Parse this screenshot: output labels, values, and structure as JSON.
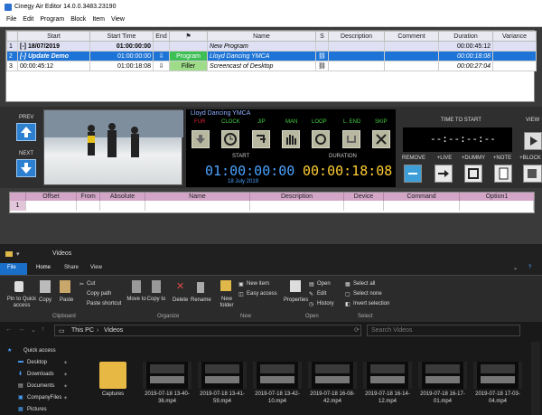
{
  "cinegy": {
    "title": "Cinegy Air Editor 14.0.0.3483.23190",
    "menu": [
      "File",
      "Edit",
      "Program",
      "Block",
      "Item",
      "View"
    ],
    "columns": [
      "",
      "Start",
      "Start Time",
      "End",
      "",
      "Name",
      "S",
      "Description",
      "Comment",
      "Duration",
      "Variance"
    ],
    "rows": [
      {
        "num": "1",
        "start": "[-] 18/07/2019",
        "start_time": "01:00:00:00",
        "type": "",
        "name": "New Program",
        "s": "",
        "duration": "00:00:45:12"
      },
      {
        "num": "2",
        "start": "[-] Update Demo",
        "start_time": "01:00:00:00",
        "type": "Program",
        "name": "Lloyd Dancing YMCA",
        "s": "",
        "duration": "00:00:18:08"
      },
      {
        "num": "3",
        "start": "00:00:45:12",
        "start_time": "01:00:18:08",
        "type": "Filler",
        "name": "Screencast of Desktop",
        "s": "",
        "duration": "00:00:27:04"
      }
    ],
    "player": {
      "prev": "PREV",
      "next": "NEXT",
      "clip_name": "Lloyd Dancing YMCA",
      "transport_labels": [
        "FUR",
        "CLOCK",
        "JIP",
        "MAN",
        "LOOP",
        "L. END",
        "SKIP"
      ],
      "start_label": "START",
      "duration_label": "DURATION",
      "start_value": "01:00:00:00",
      "duration_value": "00:00:18:08",
      "date": "18 July 2019",
      "time_to_start_label": "TIME TO START",
      "time_to_start_value": "--:--:--:--",
      "view_label": "VIEW",
      "right_labels": [
        "REMOVE",
        "+LIVE",
        "+DUMMY",
        "+NOTE",
        "+BLOCK"
      ]
    },
    "script_columns": [
      "",
      "Offset",
      "From",
      "Absolute",
      "Name",
      "Description",
      "Device",
      "Command",
      "Option1"
    ],
    "script_row": "1"
  },
  "explorer": {
    "title": "Videos",
    "tabs": [
      "File",
      "Home",
      "Share",
      "View"
    ],
    "ribbon": {
      "clipboard": {
        "pin": "Pin to Quick access",
        "copy": "Copy",
        "paste": "Paste",
        "cut": "Cut",
        "copy_path": "Copy path",
        "paste_shortcut": "Paste shortcut",
        "group": "Clipboard"
      },
      "organize": {
        "move": "Move to",
        "copy": "Copy to",
        "delete": "Delete",
        "rename": "Rename",
        "group": "Organize"
      },
      "new": {
        "folder": "New folder",
        "item": "New item",
        "easy": "Easy access",
        "group": "New"
      },
      "open": {
        "properties": "Properties",
        "open": "Open",
        "edit": "Edit",
        "history": "History",
        "group": "Open"
      },
      "select": {
        "all": "Select all",
        "none": "Select none",
        "invert": "Invert selection",
        "group": "Select"
      }
    },
    "address": [
      "This PC",
      "Videos"
    ],
    "search_placeholder": "Search Videos",
    "sidebar": [
      "Quick access",
      "Desktop",
      "Downloads",
      "Documents",
      "CompanyFiles",
      "Pictures"
    ],
    "files": [
      {
        "name": "Captures",
        "kind": "folder"
      },
      {
        "name": "2019-07-18 13-40-36.mp4",
        "kind": "video"
      },
      {
        "name": "2019-07-18 13-41-59.mp4",
        "kind": "video"
      },
      {
        "name": "2019-07-18 13-42-10.mp4",
        "kind": "video"
      },
      {
        "name": "2019-07-18 16-08-42.mp4",
        "kind": "video"
      },
      {
        "name": "2019-07-18 16-14-12.mp4",
        "kind": "video"
      },
      {
        "name": "2019-07-18 16-17-01.mp4",
        "kind": "video"
      },
      {
        "name": "2019-07-18 17-03-04.mp4",
        "kind": "video"
      }
    ]
  }
}
